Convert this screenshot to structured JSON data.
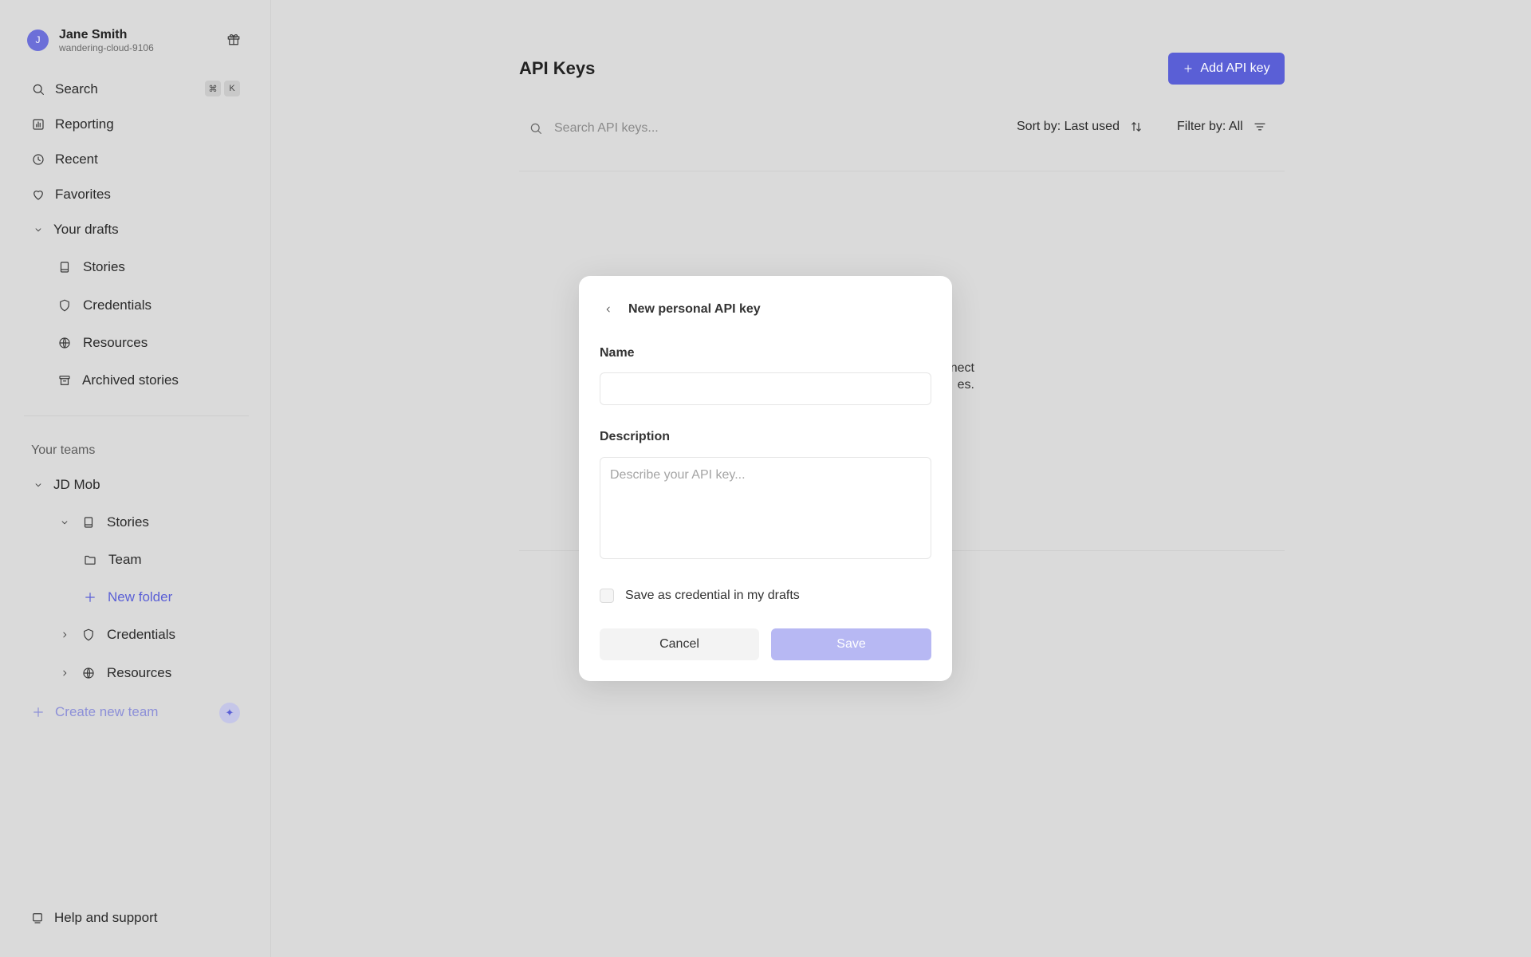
{
  "user": {
    "initial": "J",
    "name": "Jane Smith",
    "handle": "wandering-cloud-9106"
  },
  "sidebar": {
    "search_label": "Search",
    "shortcut": [
      "⌘",
      "K"
    ],
    "items": [
      {
        "label": "Reporting"
      },
      {
        "label": "Recent"
      },
      {
        "label": "Favorites"
      }
    ],
    "drafts": {
      "label": "Your drafts",
      "items": [
        {
          "label": "Stories"
        },
        {
          "label": "Credentials"
        },
        {
          "label": "Resources"
        },
        {
          "label": "Archived stories"
        }
      ]
    },
    "teams_label": "Your teams",
    "team": {
      "name": "JD Mob",
      "stories_label": "Stories",
      "team_folder": "Team",
      "new_folder": "New folder",
      "credentials_label": "Credentials",
      "resources_label": "Resources"
    },
    "create_team": "Create new team",
    "help": "Help and support"
  },
  "main": {
    "title": "API Keys",
    "add_button": "Add API key",
    "search_placeholder": "Search API keys...",
    "sort_label": "Sort by: Last used",
    "filter_label": "Filter by: All",
    "empty_line1": "nect",
    "empty_line2": "es."
  },
  "modal": {
    "title": "New personal API key",
    "name_label": "Name",
    "name_value": "",
    "description_label": "Description",
    "description_placeholder": "Describe your API key...",
    "checkbox_label": "Save as credential in my drafts",
    "cancel": "Cancel",
    "save": "Save"
  },
  "colors": {
    "accent": "#5a5fd6",
    "save_disabled": "#b7b8f3",
    "backdrop": "#dadada"
  }
}
